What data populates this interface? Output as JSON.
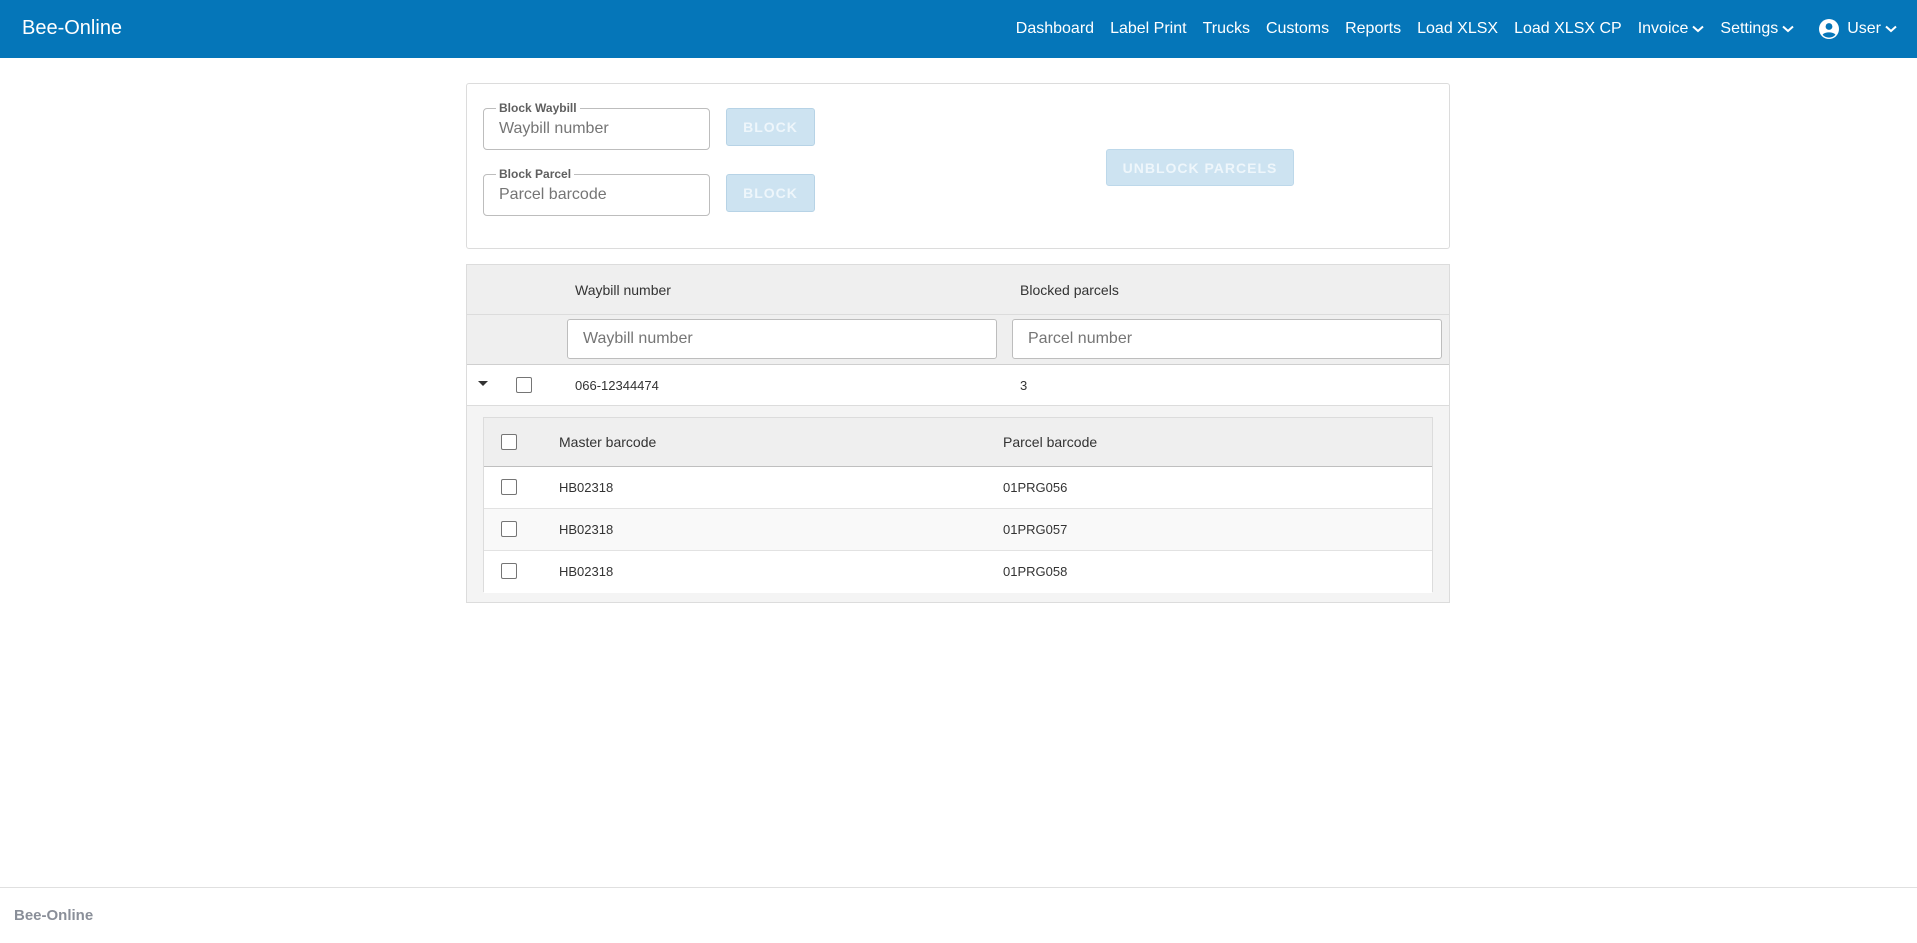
{
  "app": {
    "brand": "Bee-Online"
  },
  "nav": {
    "items": [
      "Dashboard",
      "Label Print",
      "Trucks",
      "Customs",
      "Reports",
      "Load XLSX",
      "Load XLSX CP"
    ],
    "invoice": "Invoice",
    "settings": "Settings",
    "user": "User"
  },
  "block": {
    "waybill_label": "Block Waybill",
    "waybill_placeholder": "Waybill number",
    "parcel_label": "Block Parcel",
    "parcel_placeholder": "Parcel barcode",
    "block_button": "BLOCK",
    "unblock_button": "UNBLOCK PARCELS"
  },
  "grid": {
    "col_waybill": "Waybill number",
    "col_blocked": "Blocked parcels",
    "filter_waybill_placeholder": "Waybill number",
    "filter_parcel_placeholder": "Parcel number",
    "row": {
      "waybill": "066-12344474",
      "blocked": "3"
    },
    "detail": {
      "col_master": "Master barcode",
      "col_parcel": "Parcel barcode",
      "rows": [
        {
          "master": "HB02318",
          "parcel": "01PRG056"
        },
        {
          "master": "HB02318",
          "parcel": "01PRG057"
        },
        {
          "master": "HB02318",
          "parcel": "01PRG058"
        }
      ]
    }
  },
  "footer": {
    "text": "Bee-Online"
  },
  "colors": {
    "navbar": "#0576b9",
    "button_disabled": "#cde3f1"
  }
}
